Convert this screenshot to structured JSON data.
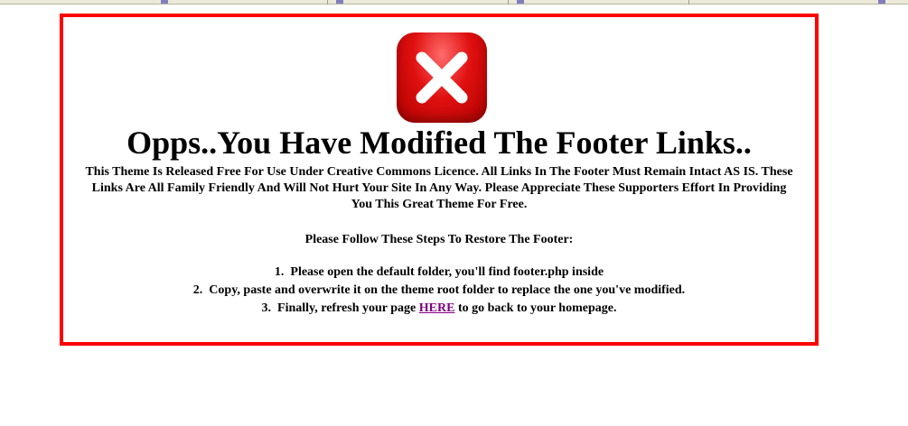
{
  "error_panel": {
    "icon": "close-x-icon",
    "border_color": "#ff0000",
    "title": "Opps..You Have Modified The Footer Links..",
    "description": "This Theme Is Released Free For Use Under Creative Commons Licence. All Links In The Footer Must Remain Intact AS IS. These Links Are All Family Friendly And Will Not Hurt Your Site In Any Way. Please Appreciate These Supporters Effort In Providing You This Great Theme For Free.",
    "steps_intro": "Please Follow These Steps To Restore The Footer:",
    "steps": [
      {
        "number": "1.",
        "text": "Please open the default folder, you'll find footer.php inside"
      },
      {
        "number": "2.",
        "text": "Copy, paste and overwrite it on the theme root folder to replace the one you've modified."
      },
      {
        "number": "3.",
        "text_before": "Finally, refresh your page",
        "link_text": "HERE",
        "text_after": "to go back to your homepage."
      }
    ],
    "link_color": "#800080"
  }
}
